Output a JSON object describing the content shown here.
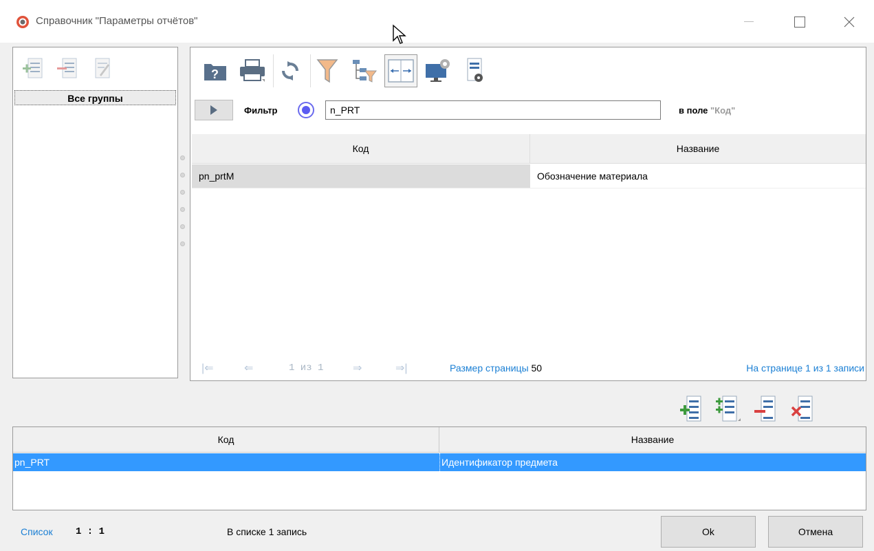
{
  "window": {
    "title": "Справочник \"Параметры отчётов\""
  },
  "groups_panel": {
    "all_groups_label": "Все группы"
  },
  "filter": {
    "label": "Фильтр",
    "value": "n_PRT",
    "in_field_prefix": "в поле",
    "in_field_name": "\"Код\""
  },
  "results_table": {
    "columns": [
      "Код",
      "Название"
    ],
    "rows": [
      {
        "code": "pn_prtM",
        "name": "Обозначение материала"
      }
    ]
  },
  "pager": {
    "page_text": "1 из 1",
    "page_size_label": "Размер страницы",
    "page_size_value": "50",
    "page_info": "На странице 1 из 1 записи"
  },
  "selected_table": {
    "columns": [
      "Код",
      "Название"
    ],
    "rows": [
      {
        "code": "pn_PRT",
        "name": "Идентификатор предмета"
      }
    ]
  },
  "status": {
    "list_label": "Список",
    "ratio": "1 : 1",
    "count": "В списке 1 запись"
  },
  "buttons": {
    "ok": "Ok",
    "cancel": "Отмена"
  },
  "colors": {
    "selection": "#3399ff",
    "link": "#1a7fd4",
    "radio": "#5b5bf2"
  }
}
